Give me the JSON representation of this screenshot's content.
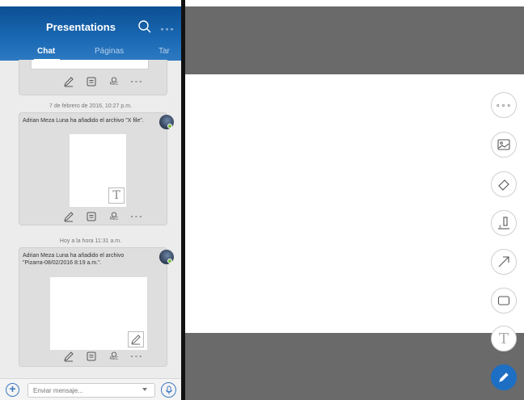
{
  "header": {
    "title": "Presentations",
    "tabs": {
      "chat": "Chat",
      "pages": "Páginas",
      "tasks": "Tar"
    }
  },
  "feed": {
    "msg1": {
      "date": "7 de febrero de 2016, 10:27 p.m.",
      "text": "Adrian Meza Luna ha añadido el archivo \"X file\"."
    },
    "msg2": {
      "date": "Hoy a la hora 11:31 a.m.",
      "text": "Adrian Meza Luna ha añadido el archivo \"Pizarra-08/02/2016 8:19 a.m.\"."
    },
    "rec_label": "REC",
    "thumb_letter": "T"
  },
  "composer": {
    "placeholder": "Enviar mensaje..."
  },
  "toolbar": {
    "tools": [
      "more-icon",
      "image-icon",
      "eraser-icon",
      "clear-icon",
      "arrow-icon",
      "rectangle-icon",
      "text-icon",
      "pen-icon"
    ],
    "text_tool_letter": "T",
    "more_label": "∘∘∘"
  },
  "colors": {
    "accent": "#1d6fc4",
    "header": "#135ea6"
  }
}
